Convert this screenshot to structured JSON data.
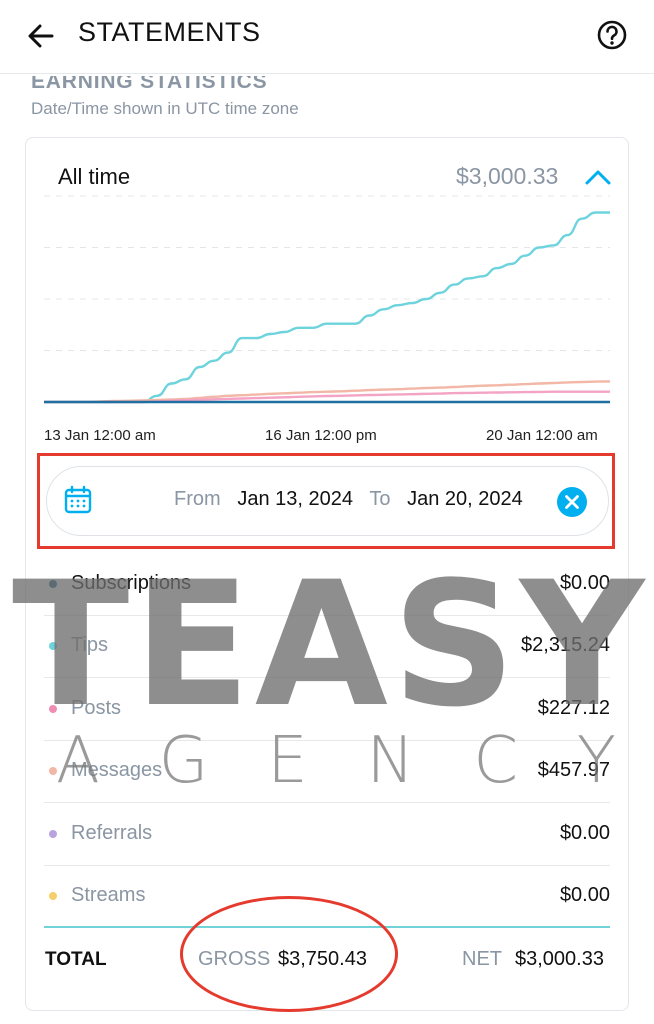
{
  "header": {
    "title": "STATEMENTS",
    "back_icon": "arrow-left-icon",
    "help_icon": "question-circle-icon"
  },
  "section": {
    "title": "EARNING STATISTICS",
    "timezone_note": "Date/Time shown in UTC time zone"
  },
  "summary": {
    "period": "All time",
    "total": "$3,000.33"
  },
  "chart_data": {
    "type": "line",
    "x_ticks": [
      "13 Jan 12:00 am",
      "16 Jan 12:00 pm",
      "20 Jan 12:00 am"
    ],
    "grid": true,
    "legend": "none",
    "series": [
      {
        "name": "Tips",
        "color": "#6dd3dc",
        "values": [
          0,
          0,
          0,
          0,
          0,
          0,
          0,
          0,
          3,
          9,
          11,
          17,
          20,
          24,
          31,
          31,
          33,
          34,
          36,
          36,
          38,
          38,
          38,
          42,
          45,
          47,
          48,
          50,
          53,
          57,
          60,
          61,
          65,
          67,
          71,
          75,
          76,
          81,
          89,
          92,
          92
        ]
      },
      {
        "name": "Messages",
        "color": "#f2b7a6",
        "values": [
          0,
          0,
          0,
          0,
          0.3,
          0.5,
          0.6,
          0.8,
          1,
          1.2,
          1.5,
          2,
          2.5,
          3,
          3.3,
          3.6,
          4,
          4.2,
          4.5,
          4.8,
          5,
          5.2,
          5.5,
          5.8,
          6,
          6.2,
          6.5,
          6.8,
          7,
          7.3,
          7.6,
          7.9,
          8.1,
          8.4,
          8.7,
          9,
          9.2,
          9.5,
          9.7,
          9.9,
          10
        ]
      },
      {
        "name": "Posts",
        "color": "#f3a3c4",
        "values": [
          0,
          0,
          0,
          0,
          0,
          0,
          0,
          0,
          0.3,
          0.6,
          0.9,
          1.1,
          1.3,
          1.5,
          1.7,
          1.9,
          2.1,
          2.3,
          2.5,
          2.7,
          2.9,
          3,
          3.2,
          3.4,
          3.5,
          3.7,
          3.8,
          4,
          4.1,
          4.3,
          4.4,
          4.5,
          4.6,
          4.7,
          4.8,
          4.9,
          5,
          5,
          5,
          5,
          5
        ]
      },
      {
        "name": "Subscriptions",
        "color": "#1f6fa0",
        "values": [
          0,
          0,
          0,
          0,
          0,
          0,
          0,
          0,
          0,
          0,
          0,
          0,
          0,
          0,
          0,
          0,
          0,
          0,
          0,
          0,
          0,
          0,
          0,
          0,
          0,
          0,
          0,
          0,
          0,
          0,
          0,
          0,
          0,
          0,
          0,
          0,
          0,
          0,
          0,
          0,
          0
        ]
      }
    ],
    "ylim": [
      0,
      100
    ]
  },
  "date_range": {
    "from_label": "From",
    "from_value": "Jan 13, 2024",
    "to_label": "To",
    "to_value": "Jan 20, 2024",
    "calendar_icon": "calendar-icon",
    "clear_icon": "close-circle-icon"
  },
  "breakdown": [
    {
      "name": "Subscriptions",
      "amount": "$0.00",
      "color": "#1f5f8b"
    },
    {
      "name": "Tips",
      "amount": "$2,315.24",
      "color": "#6dd3dc"
    },
    {
      "name": "Posts",
      "amount": "$227.12",
      "color": "#f08db4"
    },
    {
      "name": "Messages",
      "amount": "$457.97",
      "color": "#f2b7a6"
    },
    {
      "name": "Referrals",
      "amount": "$0.00",
      "color": "#b9a2e0"
    },
    {
      "name": "Streams",
      "amount": "$0.00",
      "color": "#f6cf6b"
    }
  ],
  "totals": {
    "label": "TOTAL",
    "gross_label": "GROSS",
    "gross_value": "$3,750.43",
    "net_label": "NET",
    "net_value": "$3,000.33"
  },
  "watermark": {
    "main": "TEASY",
    "sub": [
      "A",
      "G",
      "E",
      "N",
      "C",
      "Y"
    ]
  },
  "colors": {
    "accent": "#00aff0",
    "highlight": "#e53a2e"
  }
}
